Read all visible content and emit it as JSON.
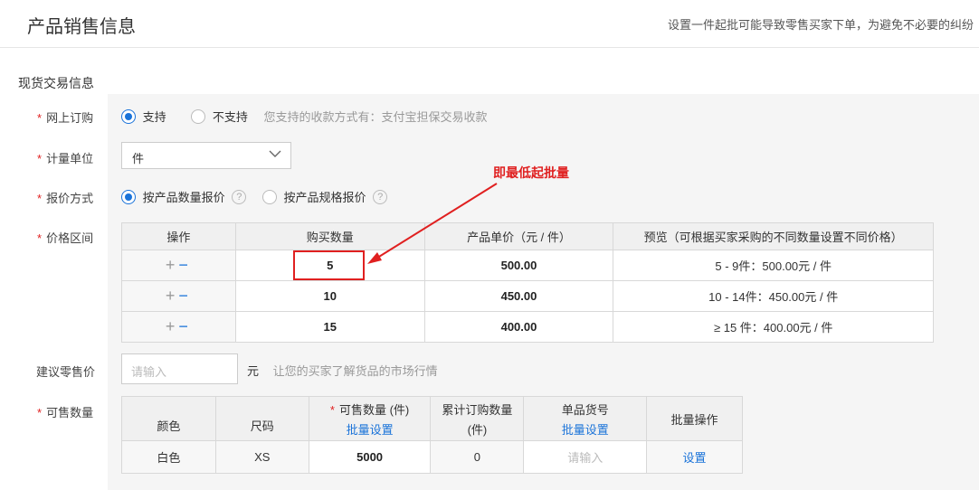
{
  "header": {
    "title": "产品销售信息",
    "hint": "设置一件起批可能导致零售买家下单，为避免不必要的纠纷"
  },
  "section_title": "现货交易信息",
  "online_order": {
    "label": "网上订购",
    "options": [
      "支持",
      "不支持"
    ],
    "selected": "支持",
    "note": "您支持的收款方式有：支付宝担保交易收款"
  },
  "unit": {
    "label": "计量单位",
    "value": "件"
  },
  "pricing_method": {
    "label": "报价方式",
    "options": [
      "按产品数量报价",
      "按产品规格报价"
    ],
    "selected": "按产品数量报价",
    "help_glyph": "?"
  },
  "price_range": {
    "label": "价格区间",
    "headers": [
      "操作",
      "购买数量",
      "产品单价（元 / 件）",
      "预览（可根据买家采购的不同数量设置不同价格）"
    ],
    "op_plus": "+",
    "op_minus": "−",
    "rows": [
      {
        "qty": "5",
        "price": "500.00",
        "preview": "5 - 9件：500.00元 / 件"
      },
      {
        "qty": "10",
        "price": "450.00",
        "preview": "10 - 14件：450.00元 / 件"
      },
      {
        "qty": "15",
        "price": "400.00",
        "preview": "≥ 15 件：400.00元 / 件"
      }
    ]
  },
  "annotation": "即最低起批量",
  "suggested_retail": {
    "label": "建议零售价",
    "placeholder": "请输入",
    "unit": "元",
    "note": "让您的买家了解货品的市场行情"
  },
  "stock": {
    "label": "可售数量",
    "headers": {
      "color": "颜色",
      "size": "尺码",
      "available": "可售数量 (件)",
      "available_link": "批量设置",
      "ordered_line1": "累计订购数量",
      "ordered_line2": "(件)",
      "sku": "单品货号",
      "sku_link": "批量设置",
      "batch": "批量操作"
    },
    "rows": [
      {
        "color": "白色",
        "size": "XS",
        "available": "5000",
        "ordered": "0",
        "sku_placeholder": "请输入",
        "action": "设置"
      }
    ]
  },
  "colors": {
    "accent": "#1a73d9",
    "required": "#e02020",
    "annotation": "#e02020"
  }
}
